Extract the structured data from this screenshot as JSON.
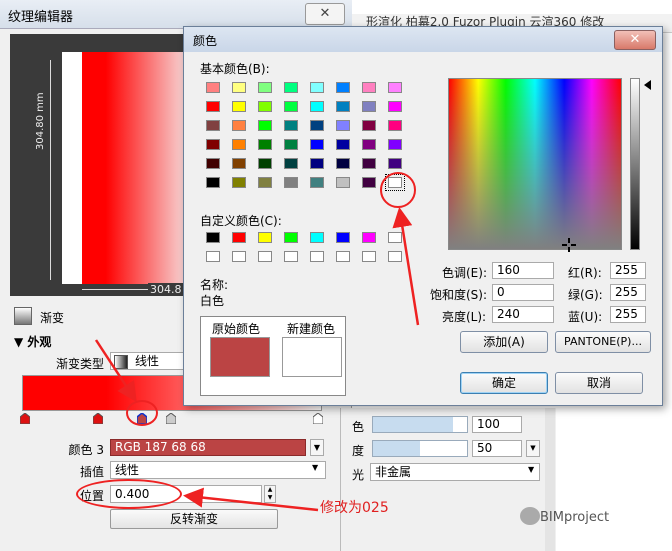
{
  "texture_editor": {
    "title": "纹理编辑器",
    "close_icon": "close-icon",
    "preview": {
      "vertical_dimension": "304.80 mm",
      "horizontal_dimension": "304.8"
    },
    "gradient_label": "渐变",
    "appearance_header": "▼ 外观",
    "gradient_type_label": "渐变类型",
    "gradient_type_value": "线性",
    "gradient_bar": {
      "start_color": "#ff0000",
      "end_color": "#ffffff"
    },
    "color_label": "颜色 3",
    "color_value": "RGB 187 68 68",
    "color_hex": "#bb4444",
    "interpolation_label": "插值",
    "interpolation_value": "线性",
    "position_label": "位置",
    "position_value": "0.400",
    "reverse_button": "反转渐变"
  },
  "background_panel": {
    "tabs_text": "形渲化   柏幕2.0   Fuzor Plugin   云渲360   修改",
    "row1": {
      "label": "色",
      "value": "100",
      "fill": 0.85
    },
    "row2": {
      "label": "度",
      "value": "50",
      "fill": 0.5
    },
    "row3": {
      "label": "光",
      "value": "非金属"
    }
  },
  "annotation": "修改为025",
  "watermark": "BIMproject",
  "color_dialog": {
    "title": "颜色",
    "basic_colors_label": "基本颜色(B):",
    "basic_colors": [
      [
        "#ff8080",
        "#ffff80",
        "#80ff80",
        "#00ff80",
        "#80ffff",
        "#0080ff",
        "#ff80c0",
        "#ff80ff"
      ],
      [
        "#ff0000",
        "#ffff00",
        "#80ff00",
        "#00ff40",
        "#00ffff",
        "#0080c0",
        "#8080c0",
        "#ff00ff"
      ],
      [
        "#804040",
        "#ff8040",
        "#00ff00",
        "#008080",
        "#004080",
        "#8080ff",
        "#800040",
        "#ff0080"
      ],
      [
        "#800000",
        "#ff8000",
        "#008000",
        "#008040",
        "#0000ff",
        "#0000a0",
        "#800080",
        "#8000ff"
      ],
      [
        "#400000",
        "#804000",
        "#004000",
        "#004040",
        "#000080",
        "#000040",
        "#400040",
        "#400080"
      ],
      [
        "#000000",
        "#808000",
        "#808040",
        "#808080",
        "#408080",
        "#c0c0c0",
        "#400040",
        "#ffffff"
      ]
    ],
    "custom_colors_label": "自定义颜色(C):",
    "custom_colors": [
      [
        "#000000",
        "#ff0000",
        "#ffff00",
        "#00ff00",
        "#00ffff",
        "#0000ff",
        "#ff00ff",
        "#ffffff"
      ],
      [
        "#ffffff",
        "#ffffff",
        "#ffffff",
        "#ffffff",
        "#ffffff",
        "#ffffff",
        "#ffffff",
        "#ffffff"
      ]
    ],
    "name_label": "名称:",
    "name_value": "白色",
    "original_label": "原始颜色",
    "new_label": "新建颜色",
    "original_color": "#bb4444",
    "new_color": "#ffffff",
    "hue_label": "色调(E):",
    "hue_value": "160",
    "sat_label": "饱和度(S):",
    "sat_value": "0",
    "lum_label": "亮度(L):",
    "lum_value": "240",
    "red_label": "红(R):",
    "red_value": "255",
    "green_label": "绿(G):",
    "green_value": "255",
    "blue_label": "蓝(U):",
    "blue_value": "255",
    "add_button": "添加(A)",
    "pantone_button": "PANTONE(P)...",
    "ok_button": "确定",
    "cancel_button": "取消"
  }
}
